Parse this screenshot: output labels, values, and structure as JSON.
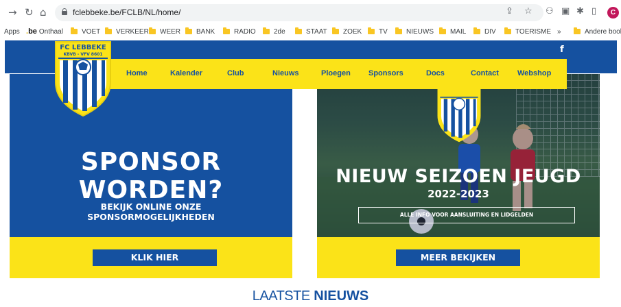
{
  "browser": {
    "url": "fclebbeke.be/FCLB/NL/home/",
    "profile_initial": "C",
    "apps_label": "Apps",
    "bookmarks": [
      {
        "label": "Onthaal",
        "icon": "be-logo-icon"
      },
      {
        "label": "VOET",
        "icon": "folder-icon"
      },
      {
        "label": "VERKEER",
        "icon": "folder-icon"
      },
      {
        "label": "WEER",
        "icon": "folder-icon"
      },
      {
        "label": "BANK",
        "icon": "folder-icon"
      },
      {
        "label": "RADIO",
        "icon": "folder-icon"
      },
      {
        "label": "2de",
        "icon": "folder-icon"
      },
      {
        "label": "STAAT",
        "icon": "folder-icon"
      },
      {
        "label": "ZOEK",
        "icon": "folder-icon"
      },
      {
        "label": "TV",
        "icon": "folder-icon"
      },
      {
        "label": "NIEUWS",
        "icon": "folder-icon"
      },
      {
        "label": "MAIL",
        "icon": "folder-icon"
      },
      {
        "label": "DIV",
        "icon": "folder-icon"
      },
      {
        "label": "TOERISME",
        "icon": "folder-icon"
      }
    ],
    "overflow_label": "»",
    "other_bookmarks": "Andere book"
  },
  "site": {
    "logo": {
      "name": "FC LEBBEKE",
      "sub": "KBVB - VFV 8601"
    },
    "nav": [
      "Home",
      "Kalender",
      "Club",
      "Nieuws",
      "Ploegen",
      "Sponsors",
      "Docs",
      "Contact",
      "Webshop"
    ],
    "social": "f",
    "sponsor": {
      "title": "SPONSOR WORDEN?",
      "subtitle_line1": "BEKIJK ONLINE ONZE",
      "subtitle_line2": "SPONSORMOGELIJKHEDEN",
      "button": "KLIK HIER"
    },
    "season": {
      "title": "NIEUW SEIZOEN JEUGD",
      "year": "2022-2023",
      "info": "ALLE INFO VOOR AANSLUITING EN LIDGELDEN",
      "button": "MEER BEKIJKEN"
    },
    "news_heading": {
      "light": "LAATSTE",
      "bold": "NIEUWS"
    }
  },
  "colors": {
    "brand_blue": "#1551a0",
    "brand_yellow": "#fbe318"
  }
}
